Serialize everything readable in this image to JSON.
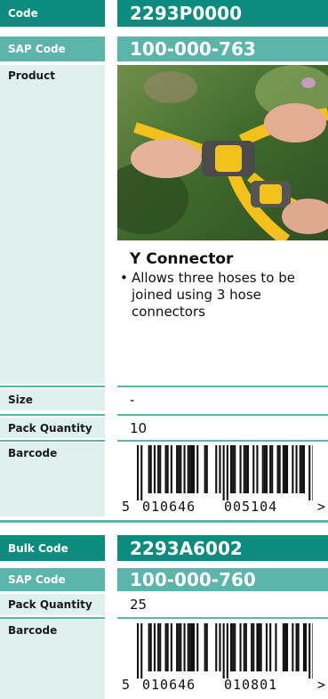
{
  "product": {
    "code_label": "Code",
    "code_value": "2293P0000",
    "sap_label": "SAP Code",
    "sap_value": "100-000-763",
    "product_label": "Product",
    "name": "Y Connector",
    "bullet": "Allows three hoses to be joined using 3 hose connectors",
    "size_label": "Size",
    "size_value": "-",
    "pack_label": "Pack Quantity",
    "pack_value": "10",
    "barcode_label": "Barcode",
    "barcode_first": "5",
    "barcode_left": "010646",
    "barcode_right": "005104",
    "barcode_arrow": ">"
  },
  "bulk": {
    "code_label": "Bulk Code",
    "code_value": "2293A6002",
    "sap_label": "SAP Code",
    "sap_value": "100-000-760",
    "pack_label": "Pack Quantity",
    "pack_value": "25",
    "barcode_label": "Barcode",
    "barcode_first": "5",
    "barcode_left": "010646",
    "barcode_right": "010801",
    "barcode_arrow": ">"
  },
  "colors": {
    "teal": "#0b8c7e",
    "teal_light": "#5bb5ab",
    "panel": "#dff0ee",
    "hose_yellow": "#f2c21a",
    "foliage": "#4c7a34"
  }
}
